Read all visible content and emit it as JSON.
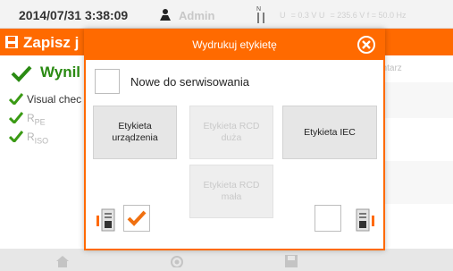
{
  "status": {
    "datetime": "2014/07/31 3:38:09",
    "user": "Admin",
    "measurements": "U   = 0.3 V U   = 235.6 V f = 50.0 Hz"
  },
  "background": {
    "title": "Zapisz j",
    "result": "Wynil",
    "comment": "entarz",
    "lines": [
      "Visual chec",
      "R",
      "R"
    ],
    "subs": [
      "",
      "PE",
      "ISO"
    ]
  },
  "modal": {
    "title": "Wydrukuj etykietę",
    "new_service_label": "Nowe do serwisowania",
    "options": [
      {
        "label": "Etykieta\nurządzenia",
        "enabled": true
      },
      {
        "label": "Etykieta RCD\nduża",
        "enabled": false
      },
      {
        "label": "Etykieta IEC",
        "enabled": true
      },
      {
        "label": "Etykieta RCD\nmała",
        "enabled": false
      }
    ],
    "left_printer_checked": true,
    "right_printer_checked": false
  },
  "colors": {
    "accent": "#ff6a00",
    "check_orange": "#f07010",
    "check_green": "#3a9a14"
  },
  "icons": [
    "user-icon",
    "measurement-icon",
    "save-icon",
    "close-icon",
    "check-icon",
    "label-printer-left-icon",
    "label-printer-right-icon",
    "home-icon",
    "record-icon",
    "floppy-icon"
  ]
}
